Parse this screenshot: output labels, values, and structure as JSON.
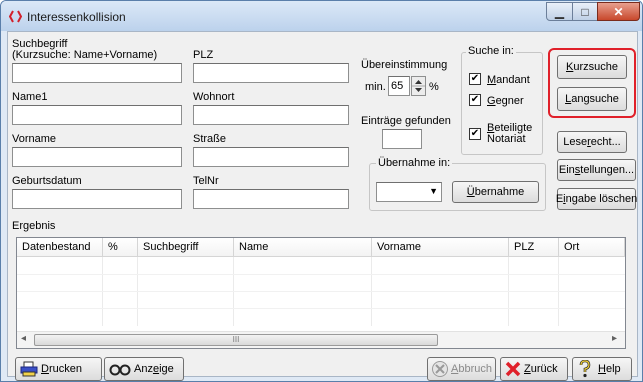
{
  "window": {
    "title": "Interessenkollision",
    "caption_min": "▁",
    "caption_max": "□",
    "caption_close": "✕"
  },
  "fields": {
    "suchbegriff_label": "Suchbegriff",
    "suchbegriff_hint": "(Kurzsuche: Name+Vorname)",
    "plz_label": "PLZ",
    "name1_label": "Name1",
    "wohnort_label": "Wohnort",
    "vorname_label": "Vorname",
    "strasse_label": "Straße",
    "geburtsdatum_label": "Geburtsdatum",
    "telnr_label": "TelNr"
  },
  "match": {
    "label": "Übereinstimmung",
    "min_label": "min.",
    "value": "65",
    "unit": "%"
  },
  "entries_found_label": "Einträge gefunden",
  "suche_in": {
    "title": "Suche in:",
    "mandant": {
      "label": "Mandant",
      "checked": true
    },
    "gegner": {
      "label": "Gegner",
      "checked": true
    },
    "beteiligte": {
      "label": "Beteiligte",
      "label2": "Notariat",
      "checked": true
    }
  },
  "uebernahme": {
    "title": "Übernahme in:",
    "button": "Übernahme",
    "dropdown_arrow": "▼"
  },
  "buttons": {
    "kurzsuche": "Kurzsuche",
    "langsuche": "Langsuche",
    "leserecht": "Leserecht...",
    "einstellungen": "Einstellungen...",
    "eingabe_loeschen": "Eingabe löschen"
  },
  "ergebnis": {
    "label": "Ergebnis",
    "columns": [
      "Datenbestand",
      "%",
      "Suchbegriff",
      "Name",
      "Vorname",
      "PLZ",
      "Ort"
    ],
    "scroll_left": "◂",
    "scroll_right": "▸",
    "scroll_thumb": "III"
  },
  "bottom": {
    "drucken": "Drucken",
    "anzeige": "Anzeige",
    "abbruch": "Abbruch",
    "zurueck": "Zurück",
    "help": "Help"
  },
  "colors": {
    "highlight": "#e0202a",
    "link_blue": "#1e63c8"
  }
}
